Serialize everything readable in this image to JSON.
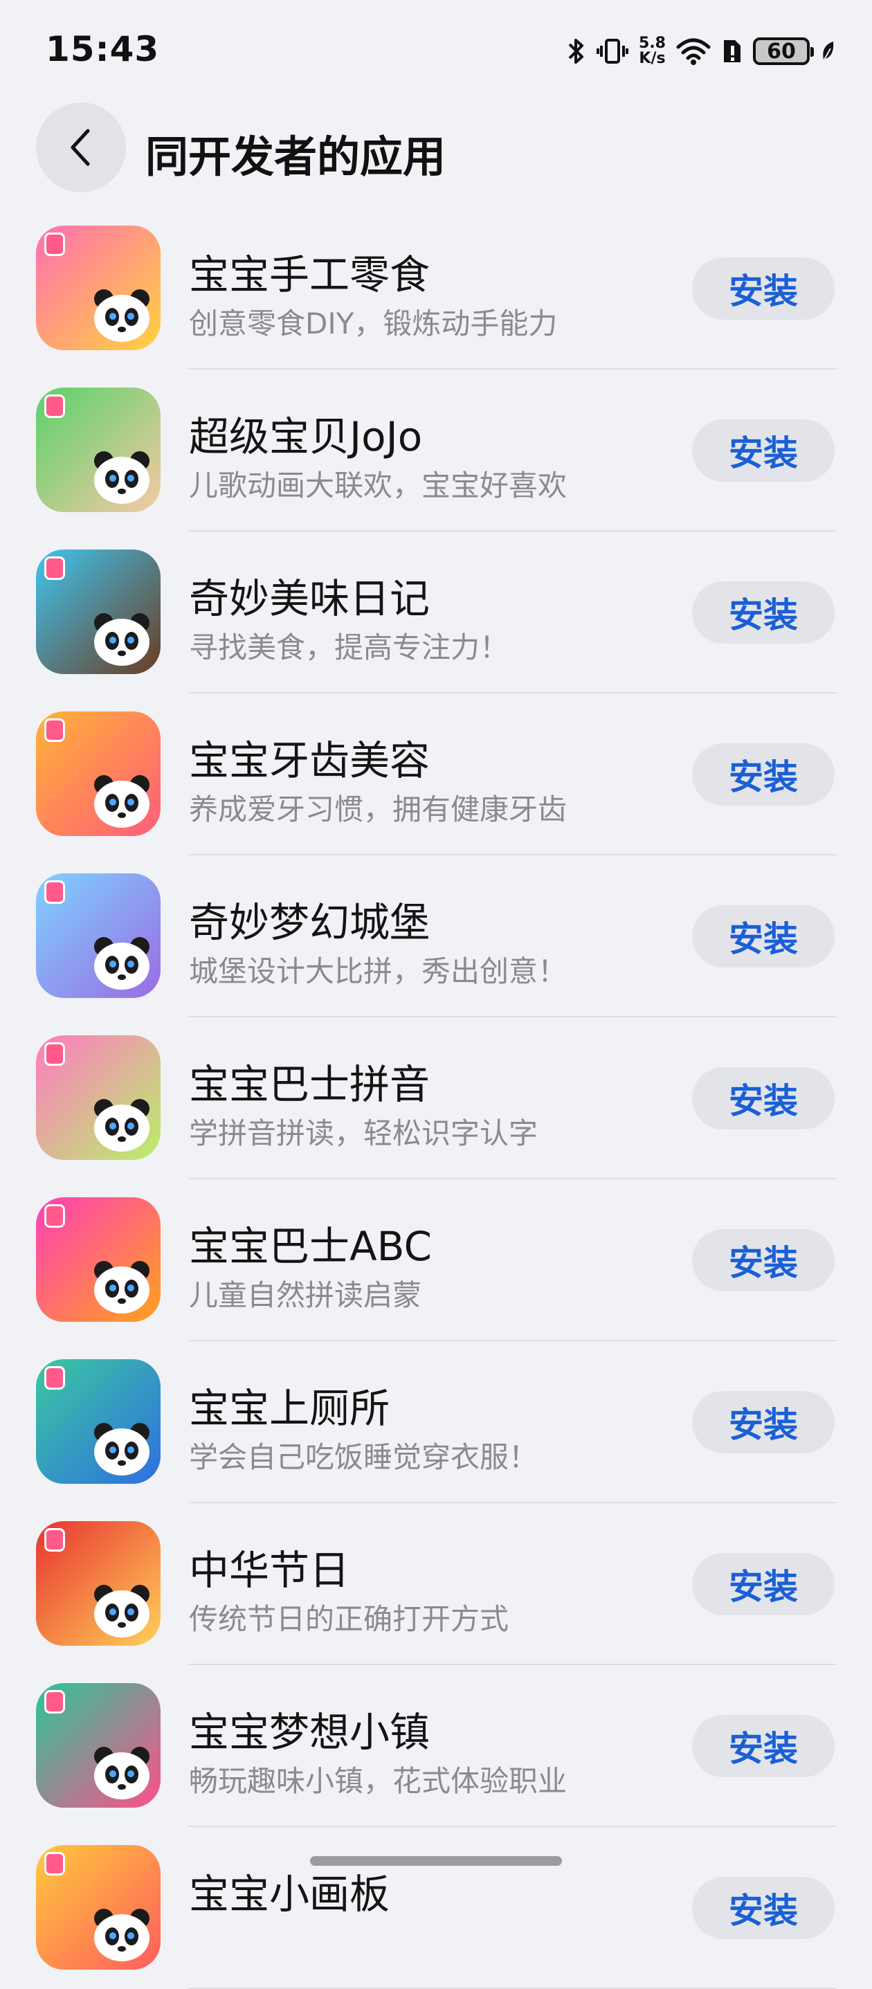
{
  "status": {
    "time": "15:43",
    "speed_value": "5.8",
    "speed_unit": "K/s",
    "battery": "60"
  },
  "header": {
    "title": "同开发者的应用"
  },
  "apps": [
    {
      "name": "宝宝手工零食",
      "desc": "创意零食DIY，锻炼动手能力",
      "install": "安装",
      "color1": "#ff6fb0",
      "color2": "#ffd23f"
    },
    {
      "name": "超级宝贝JoJo",
      "desc": "儿歌动画大联欢，宝宝好喜欢",
      "install": "安装",
      "color1": "#58d26b",
      "color2": "#f7c9a3"
    },
    {
      "name": "奇妙美味日记",
      "desc": "寻找美食，提高专注力！",
      "install": "安装",
      "color1": "#3fc6ef",
      "color2": "#6b3b22"
    },
    {
      "name": "宝宝牙齿美容",
      "desc": "养成爱牙习惯，拥有健康牙齿",
      "install": "安装",
      "color1": "#ffb238",
      "color2": "#ff5d7a"
    },
    {
      "name": "奇妙梦幻城堡",
      "desc": "城堡设计大比拼，秀出创意！",
      "install": "安装",
      "color1": "#7ed2ff",
      "color2": "#9b6be3"
    },
    {
      "name": "宝宝巴士拼音",
      "desc": "学拼音拼读，轻松识字认字",
      "install": "安装",
      "color1": "#ff7ac2",
      "color2": "#b9f06a"
    },
    {
      "name": "宝宝巴士ABC",
      "desc": "儿童自然拼读启蒙",
      "install": "安装",
      "color1": "#ff3fb8",
      "color2": "#ffa21d"
    },
    {
      "name": "宝宝上厕所",
      "desc": "学会自己吃饭睡觉穿衣服！",
      "install": "安装",
      "color1": "#3cc8a0",
      "color2": "#2e6fe0"
    },
    {
      "name": "中华节日",
      "desc": "传统节日的正确打开方式",
      "install": "安装",
      "color1": "#e8322f",
      "color2": "#ffd15a"
    },
    {
      "name": "宝宝梦想小镇",
      "desc": "畅玩趣味小镇，花式体验职业",
      "install": "安装",
      "color1": "#29c79a",
      "color2": "#ff4f8b"
    },
    {
      "name": "宝宝小画板",
      "desc": "",
      "install": "安装",
      "color1": "#ffc93c",
      "color2": "#ff5d5d"
    }
  ]
}
